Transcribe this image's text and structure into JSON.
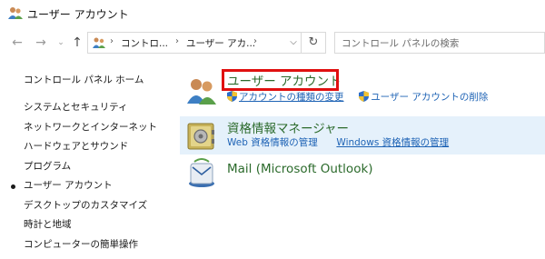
{
  "window": {
    "title": "ユーザー アカウント",
    "icon": "users-icon"
  },
  "navbar": {
    "back_icon": "back-arrow-icon",
    "forward_icon": "forward-arrow-icon",
    "recent_icon": "chevron-down-icon",
    "up_icon": "up-arrow-icon",
    "breadcrumbs": [
      "コントロ...",
      "ユーザー アカ..."
    ],
    "refresh_icon": "refresh-icon",
    "search_placeholder": "コントロール パネルの検索"
  },
  "left_pane": {
    "home_label": "コントロール パネル ホーム",
    "items": [
      {
        "label": "システムとセキュリティ",
        "current": false
      },
      {
        "label": "ネットワークとインターネット",
        "current": false
      },
      {
        "label": "ハードウェアとサウンド",
        "current": false
      },
      {
        "label": "プログラム",
        "current": false
      },
      {
        "label": "ユーザー アカウント",
        "current": true
      },
      {
        "label": "デスクトップのカスタマイズ",
        "current": false
      },
      {
        "label": "時計と地域",
        "current": false
      },
      {
        "label": "コンピューターの簡単操作",
        "current": false
      }
    ]
  },
  "categories": [
    {
      "heading": "ユーザー アカウント",
      "icon": "user-accounts-icon",
      "highlight_color": "#e01010",
      "links": [
        "アカウントの種類の変更",
        "ユーザー アカウントの削除"
      ]
    },
    {
      "heading": "資格情報マネージャー",
      "icon": "credential-vault-icon",
      "links": [
        "Web 資格情報の管理",
        "Windows 資格情報の管理"
      ]
    },
    {
      "heading": "Mail (Microsoft Outlook)",
      "icon": "mail-icon",
      "links": []
    }
  ],
  "colors": {
    "heading_green": "#2b6a2b",
    "link_blue": "#1e63b5",
    "hover_row": "#e5f1fb",
    "highlight_red": "#e01010"
  }
}
